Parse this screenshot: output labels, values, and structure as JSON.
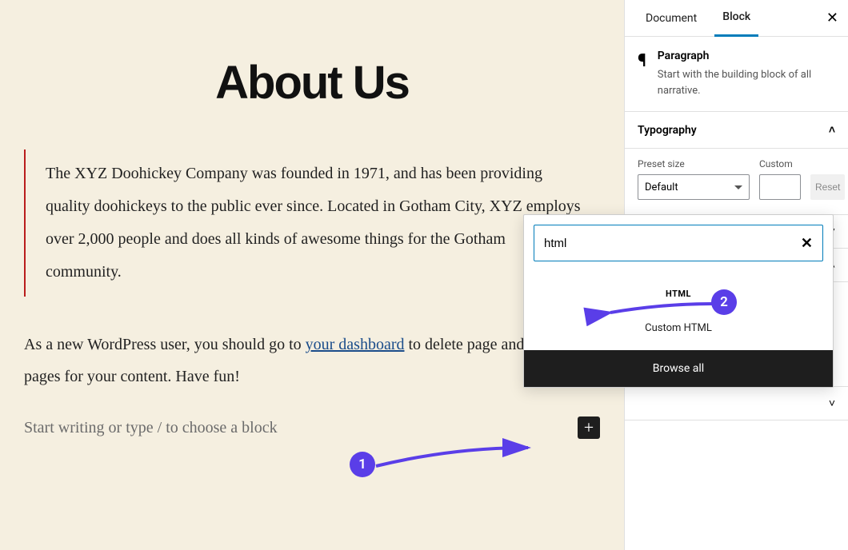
{
  "page": {
    "title": "About Us",
    "quote": "The XYZ Doohickey Company was founded in 1971, and has been providing quality doohickeys to the public ever since. Located in Gotham City, XYZ employs over 2,000 people and does all kinds of awesome things for the Gotham community.",
    "para_before": "As a new WordPress user, you should go to ",
    "para_link": "your dashboard",
    "para_after": " to delete page and create new pages for your content. Have fun!",
    "placeholder": "Start writing or type / to choose a block"
  },
  "sidebar": {
    "tabs": {
      "document": "Document",
      "block": "Block"
    },
    "block": {
      "title": "Paragraph",
      "description": "Start with the building block of all narrative."
    },
    "typography": {
      "heading": "Typography",
      "preset_label": "Preset size",
      "preset_value": "Default",
      "custom_label": "Custom",
      "reset": "Reset"
    }
  },
  "inserter": {
    "search_value": "html",
    "result_icon_label": "HTML",
    "result_name": "Custom HTML",
    "browse": "Browse all"
  },
  "annotations": {
    "b1": "1",
    "b2": "2"
  }
}
